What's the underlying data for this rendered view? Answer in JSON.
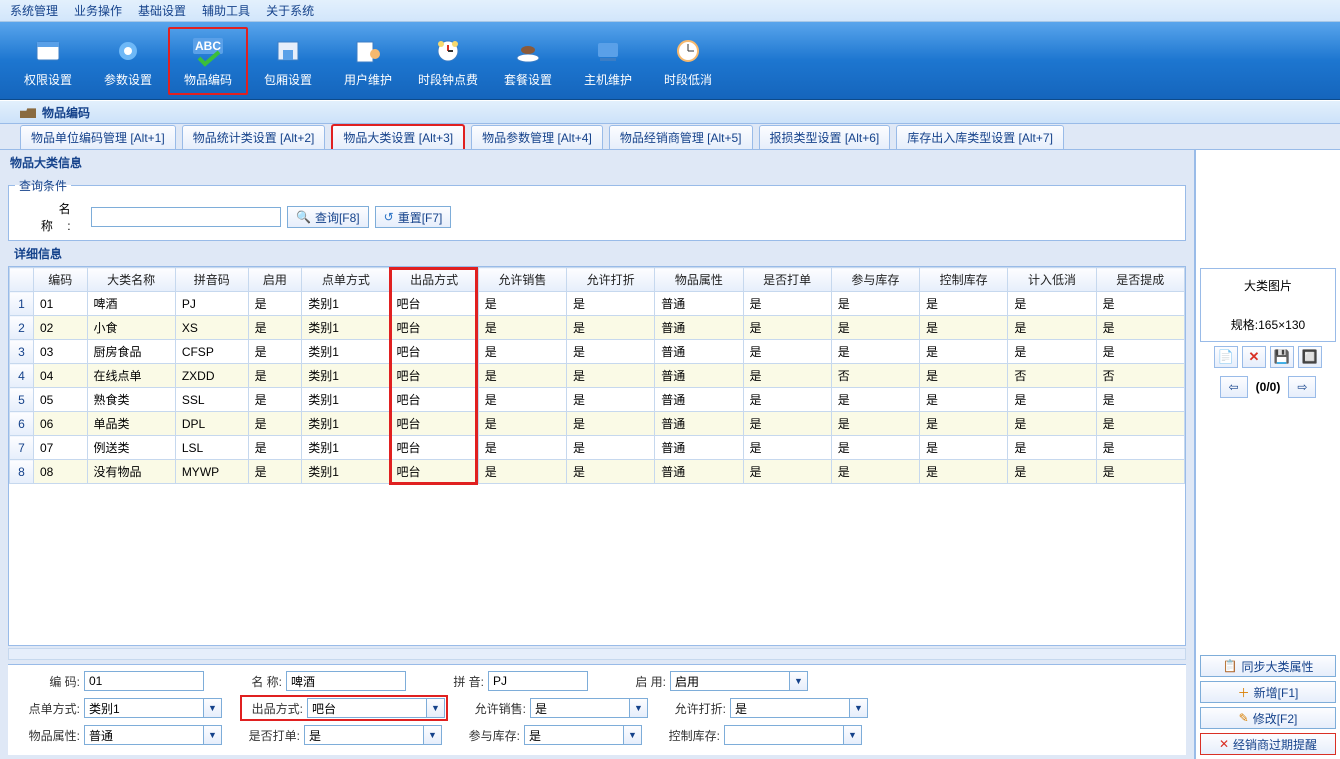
{
  "menu": [
    "系统管理",
    "业务操作",
    "基础设置",
    "辅助工具",
    "关于系统"
  ],
  "ribbon": [
    {
      "label": "权限设置",
      "icon": "auth"
    },
    {
      "label": "参数设置",
      "icon": "gear"
    },
    {
      "label": "物品编码",
      "icon": "abc",
      "hi": true
    },
    {
      "label": "包厢设置",
      "icon": "room"
    },
    {
      "label": "用户维护",
      "icon": "user"
    },
    {
      "label": "时段钟点费",
      "icon": "clock"
    },
    {
      "label": "套餐设置",
      "icon": "package"
    },
    {
      "label": "主机维护",
      "icon": "host"
    },
    {
      "label": "时段低消",
      "icon": "lowtime"
    }
  ],
  "page_title": "物品编码",
  "tabs": [
    {
      "label": "物品单位编码管理 [Alt+1]"
    },
    {
      "label": "物品统计类设置 [Alt+2]"
    },
    {
      "label": "物品大类设置 [Alt+3]",
      "hi": true
    },
    {
      "label": "物品参数管理 [Alt+4]"
    },
    {
      "label": "物品经销商管理 [Alt+5]"
    },
    {
      "label": "报损类型设置 [Alt+6]"
    },
    {
      "label": "库存出入库类型设置 [Alt+7]"
    }
  ],
  "section_title": "物品大类信息",
  "query": {
    "legend": "查询条件",
    "name_label": "名 称:",
    "search_btn": "查询[F8]",
    "reset_btn": "重置[F7]"
  },
  "detail_legend": "详细信息",
  "columns": [
    "编码",
    "大类名称",
    "拼音码",
    "启用",
    "点单方式",
    "出品方式",
    "允许销售",
    "允许打折",
    "物品属性",
    "是否打单",
    "参与库存",
    "控制库存",
    "计入低消",
    "是否提成"
  ],
  "rows": [
    [
      "01",
      "啤酒",
      "PJ",
      "是",
      "类别1",
      "吧台",
      "是",
      "是",
      "普通",
      "是",
      "是",
      "是",
      "是",
      "是"
    ],
    [
      "02",
      "小食",
      "XS",
      "是",
      "类别1",
      "吧台",
      "是",
      "是",
      "普通",
      "是",
      "是",
      "是",
      "是",
      "是"
    ],
    [
      "03",
      "厨房食品",
      "CFSP",
      "是",
      "类别1",
      "吧台",
      "是",
      "是",
      "普通",
      "是",
      "是",
      "是",
      "是",
      "是"
    ],
    [
      "04",
      "在线点单",
      "ZXDD",
      "是",
      "类别1",
      "吧台",
      "是",
      "是",
      "普通",
      "是",
      "否",
      "是",
      "否",
      "否"
    ],
    [
      "05",
      "熟食类",
      "SSL",
      "是",
      "类别1",
      "吧台",
      "是",
      "是",
      "普通",
      "是",
      "是",
      "是",
      "是",
      "是"
    ],
    [
      "06",
      "单品类",
      "DPL",
      "是",
      "类别1",
      "吧台",
      "是",
      "是",
      "普通",
      "是",
      "是",
      "是",
      "是",
      "是"
    ],
    [
      "07",
      "例送类",
      "LSL",
      "是",
      "类别1",
      "吧台",
      "是",
      "是",
      "普通",
      "是",
      "是",
      "是",
      "是",
      "是"
    ],
    [
      "08",
      "没有物品",
      "MYWP",
      "是",
      "类别1",
      "吧台",
      "是",
      "是",
      "普通",
      "是",
      "是",
      "是",
      "是",
      "是"
    ]
  ],
  "form": {
    "code": {
      "label": "编 码:",
      "value": "01"
    },
    "name": {
      "label": "名 称:",
      "value": "啤酒"
    },
    "pinyin": {
      "label": "拼 音:",
      "value": "PJ"
    },
    "enable": {
      "label": "启 用:",
      "value": "启用"
    },
    "order_mode": {
      "label": "点单方式:",
      "value": "类别1"
    },
    "produce_mode": {
      "label": "出品方式:",
      "value": "吧台"
    },
    "allow_sale": {
      "label": "允许销售:",
      "value": "是"
    },
    "allow_discount": {
      "label": "允许打折:",
      "value": "是"
    },
    "item_attr": {
      "label": "物品属性:",
      "value": "普通"
    },
    "print": {
      "label": "是否打单:",
      "value": "是"
    },
    "stock": {
      "label": "参与库存:",
      "value": "是"
    },
    "ctrl_stock": {
      "label": "控制库存:",
      "value": ""
    }
  },
  "side": {
    "img_title": "大类图片",
    "img_spec": "规格:165×130",
    "pager": "(0/0)",
    "sync": "同步大类属性",
    "add": "新增[F1]",
    "edit": "修改[F2]",
    "remind": "经销商过期提醒"
  }
}
